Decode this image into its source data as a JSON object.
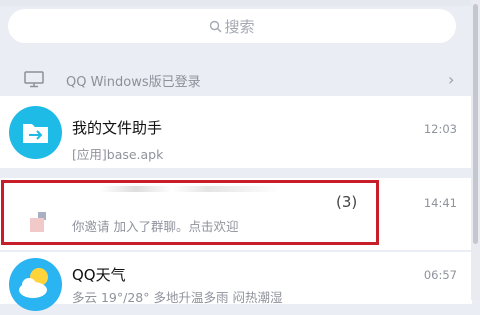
{
  "search": {
    "label": "搜索"
  },
  "login_bar": {
    "text": "QQ Windows版已登录"
  },
  "chats": [
    {
      "name": "我的文件助手",
      "preview": "[应用]base.apk",
      "time": "12:03"
    },
    {
      "name": "",
      "preview": "你邀请        加入了群聊。点击欢迎",
      "time": "14:41",
      "badge": "(3)"
    },
    {
      "name": "QQ天气",
      "preview": "多云 19°/28° 多地升温多雨 闷热潮湿",
      "time": "06:57"
    }
  ],
  "colors": {
    "highlight_box": "#c81e2a",
    "file_helper_avatar": "#1dbbe6",
    "weather_avatar": "#2ab4f2"
  }
}
